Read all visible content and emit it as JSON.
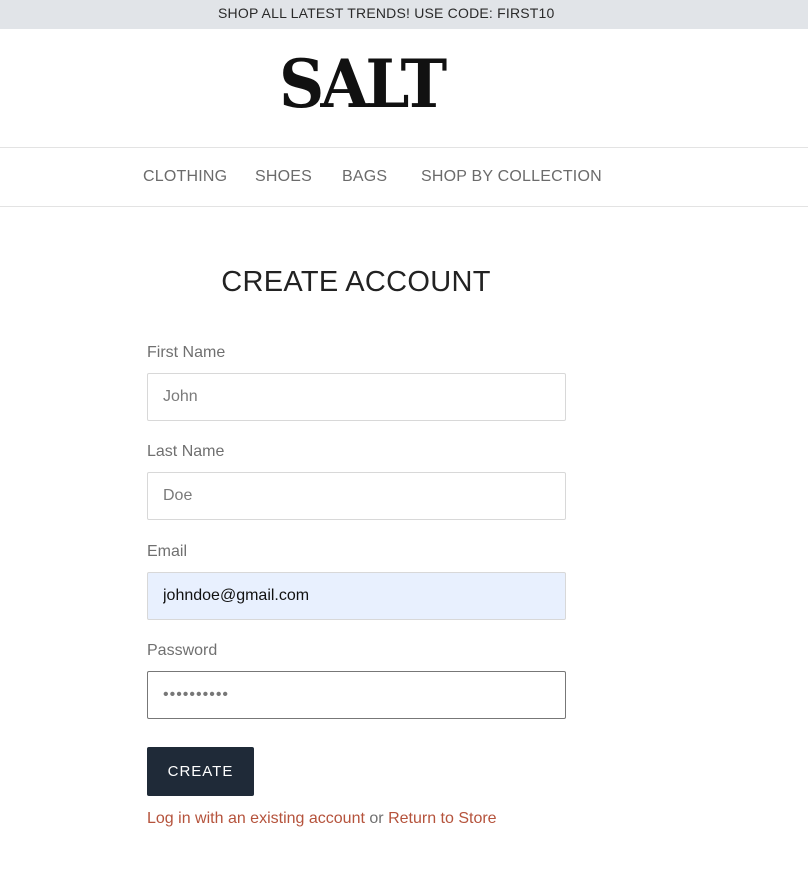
{
  "announcement": {
    "text": "SHOP ALL LATEST TRENDS! USE CODE: FIRST10"
  },
  "header": {
    "logo_text": "SALT"
  },
  "nav": {
    "items": [
      {
        "label": "CLOTHING"
      },
      {
        "label": "SHOES"
      },
      {
        "label": "BAGS"
      },
      {
        "label": "SHOP BY COLLECTION"
      }
    ]
  },
  "form": {
    "title": "CREATE ACCOUNT",
    "first_name": {
      "label": "First Name",
      "value": "John"
    },
    "last_name": {
      "label": "Last Name",
      "value": "Doe"
    },
    "email": {
      "label": "Email",
      "value": "johndoe@gmail.com"
    },
    "password": {
      "label": "Password",
      "value": "••••••••••"
    },
    "submit_label": "CREATE"
  },
  "footer_links": {
    "login_label": "Log in with an existing account",
    "separator": "or",
    "return_label": "Return to Store"
  },
  "colors": {
    "announcement_bg": "#e1e4e8",
    "button_bg": "#1f2a38",
    "link": "#b5533c",
    "autofill_bg": "#e8f0fe"
  }
}
